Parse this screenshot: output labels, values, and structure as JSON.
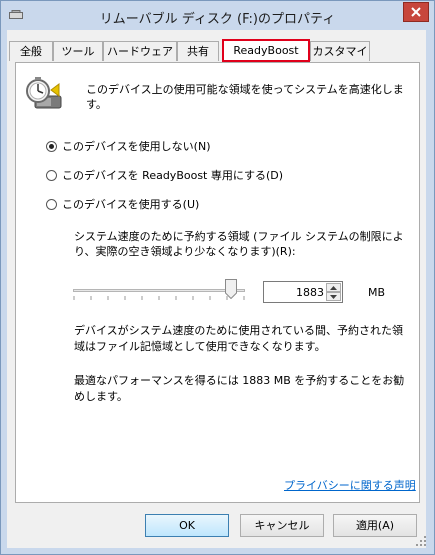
{
  "window": {
    "title": "リムーバブル ディスク (F:)のプロパティ"
  },
  "tabs": [
    {
      "label": "全般"
    },
    {
      "label": "ツール"
    },
    {
      "label": "ハードウェア"
    },
    {
      "label": "共有"
    },
    {
      "label": "ReadyBoost"
    },
    {
      "label": "カスタマイズ"
    }
  ],
  "readyboost": {
    "description": "このデバイス上の使用可能な領域を使ってシステムを高速化します。",
    "options": [
      {
        "label": "このデバイスを使用しない(N)",
        "selected": true
      },
      {
        "label": "このデバイスを ReadyBoost 専用にする(D)",
        "selected": false
      },
      {
        "label": "このデバイスを使用する(U)",
        "selected": false
      }
    ],
    "reserve_label": "システム速度のために予約する領域 (ファイル システムの制限により、実際の空き領域より少なくなります)(R):",
    "slider_level": 0.92,
    "reserve_value": "1883",
    "unit": "MB",
    "note_in_use": "デバイスがシステム速度のために使用されている間、予約された領域はファイル記憶域として使用できなくなります。",
    "recommendation": "最適なパフォーマンスを得るには 1883 MB を予約することをお勧めします。",
    "privacy_link": "プライバシーに関する声明"
  },
  "buttons": {
    "ok": "OK",
    "cancel": "キャンセル",
    "apply": "適用(A)"
  },
  "colors": {
    "active_tab_highlight": "#e0001b",
    "close_button": "#c7463c",
    "link": "#0066cc"
  }
}
